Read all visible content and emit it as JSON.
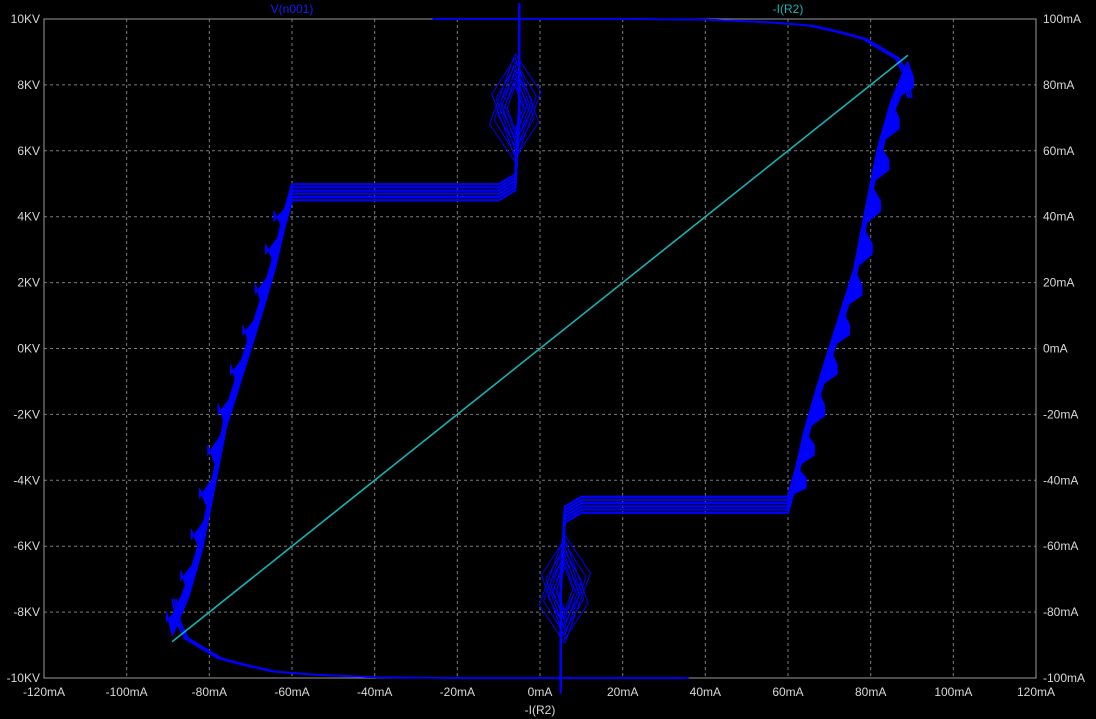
{
  "chart_data": {
    "type": "line",
    "xlabel": "-I(R2)",
    "x_axis": {
      "min": -120,
      "max": 120,
      "ticks": [
        -120,
        -100,
        -80,
        -60,
        -40,
        -20,
        0,
        20,
        40,
        60,
        80,
        100,
        120
      ],
      "tick_labels": [
        "-120mA",
        "-100mA",
        "-80mA",
        "-60mA",
        "-40mA",
        "-20mA",
        "0mA",
        "20mA",
        "40mA",
        "60mA",
        "80mA",
        "100mA",
        "120mA"
      ]
    },
    "y_left": {
      "min": -10,
      "max": 10,
      "ticks": [
        10,
        8,
        6,
        4,
        2,
        0,
        -2,
        -4,
        -6,
        -8,
        -10
      ],
      "tick_labels": [
        "10KV",
        "8KV",
        "6KV",
        "4KV",
        "2KV",
        "0KV",
        "-2KV",
        "-4KV",
        "-6KV",
        "-8KV",
        "-10KV"
      ]
    },
    "y_right": {
      "min": -100,
      "max": 100,
      "ticks": [
        100,
        80,
        60,
        40,
        20,
        0,
        -20,
        -40,
        -60,
        -80,
        -100
      ],
      "tick_labels": [
        "100mA",
        "80mA",
        "60mA",
        "40mA",
        "20mA",
        "0mA",
        "-20mA",
        "-40mA",
        "-60mA",
        "-80mA",
        "-100mA"
      ]
    },
    "grid": true,
    "series": [
      {
        "name": "V(n001)",
        "axis": "left",
        "color": "#0000ff",
        "upper_branch": {
          "x": [
            -89,
            -85,
            -82,
            -80,
            -78,
            -76,
            -73,
            -70,
            -67,
            -64,
            -62,
            -60,
            -50,
            -40,
            -30,
            -20,
            -10,
            -6,
            -5,
            -5
          ],
          "y": [
            -8.7,
            -7.5,
            -6.2,
            -5,
            -3.7,
            -2.4,
            -1.2,
            0,
            1.2,
            2.5,
            3.6,
            4.5,
            4.5,
            4.5,
            4.5,
            4.5,
            4.5,
            4.8,
            7,
            10
          ]
        },
        "lower_branch": {
          "x": [
            89,
            85,
            82,
            80,
            78,
            76,
            73,
            70,
            67,
            64,
            62,
            60,
            50,
            40,
            30,
            20,
            10,
            6,
            5,
            5
          ],
          "y": [
            8.7,
            7.5,
            6.2,
            5,
            3.7,
            2.4,
            1.2,
            0,
            -1.2,
            -2.5,
            -3.6,
            -4.5,
            -4.5,
            -4.5,
            -4.5,
            -4.5,
            -4.5,
            -4.8,
            -7,
            -10
          ]
        },
        "top_edge": {
          "x": [
            -26,
            0,
            20,
            40,
            55,
            65,
            72,
            78,
            82,
            86,
            88,
            89
          ],
          "y": [
            10,
            10,
            10,
            9.98,
            9.9,
            9.8,
            9.6,
            9.4,
            9.1,
            8.8,
            8.3,
            7.6
          ]
        },
        "bottom_edge": {
          "x": [
            35,
            0,
            -20,
            -40,
            -55,
            -65,
            -72,
            -78,
            -82,
            -86,
            -88,
            -89
          ],
          "y": [
            -10,
            -10,
            -10,
            -9.98,
            -9.9,
            -9.8,
            -9.6,
            -9.4,
            -9.1,
            -8.8,
            -8.3,
            -7.6
          ]
        },
        "loop_upper": {
          "x": [
            -6
          ],
          "y": [
            7.3
          ]
        },
        "loop_lower": {
          "x": [
            6
          ],
          "y": [
            -7.3
          ]
        }
      },
      {
        "name": "-I(R2)",
        "axis": "right",
        "color": "#14b4b4",
        "x": [
          -89,
          89
        ],
        "y": [
          -89,
          89
        ]
      }
    ]
  }
}
